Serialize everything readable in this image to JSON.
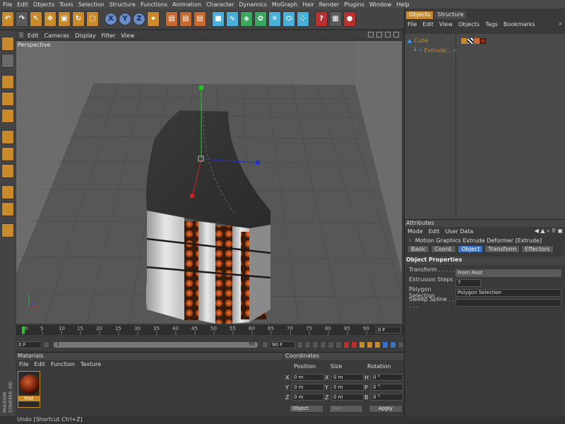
{
  "menubar": [
    "File",
    "Edit",
    "Objects",
    "Tools",
    "Selection",
    "Structure",
    "Functions",
    "Animation",
    "Character",
    "Dynamics",
    "MoGraph",
    "Hair",
    "Render",
    "Plugins",
    "Window",
    "Help"
  ],
  "toolbar": {
    "axis_x": "X",
    "axis_y": "Y",
    "axis_z": "Z"
  },
  "viewport": {
    "menu": [
      "Edit",
      "Cameras",
      "Display",
      "Filter",
      "View"
    ],
    "label": "Perspective"
  },
  "timeline": {
    "ticks": [
      "0",
      "5",
      "10",
      "15",
      "20",
      "25",
      "30",
      "35",
      "40",
      "45",
      "50",
      "55",
      "60",
      "65",
      "70",
      "75",
      "80",
      "85",
      "90"
    ],
    "current_frame": "0 F",
    "start_frame": "0 F",
    "slider_value": "1",
    "slider_end_value": "90",
    "end_frame": "90 F"
  },
  "materials": {
    "title": "Materials",
    "menu": [
      "File",
      "Edit",
      "Function",
      "Texture"
    ],
    "item_name": "Mat"
  },
  "coordinates": {
    "title": "Coordinates",
    "headers": [
      "Position",
      "Size",
      "Rotation"
    ],
    "rows": [
      {
        "axis_pos": "X",
        "pos": "0 m",
        "axis_size": "X",
        "size": "0 m",
        "axis_rot": "H",
        "rot": "0 °"
      },
      {
        "axis_pos": "Y",
        "pos": "0 m",
        "axis_size": "Y",
        "size": "0 m",
        "axis_rot": "P",
        "rot": "0 °"
      },
      {
        "axis_pos": "Z",
        "pos": "0 m",
        "axis_size": "Z",
        "size": "0 m",
        "axis_rot": "B",
        "rot": "0 °"
      }
    ],
    "mode_select": "Object",
    "size_select": "Size",
    "apply_label": "Apply"
  },
  "status": "Undo [Shortcut Ctrl+Z]",
  "logo": "MAXON CINEMA 4D",
  "object_manager": {
    "tabs": [
      "Objects",
      "Structure"
    ],
    "menu": [
      "File",
      "Edit",
      "View",
      "Objects",
      "Tags",
      "Bookmarks"
    ],
    "tree": [
      {
        "name": "Cube"
      },
      {
        "name": "Extrude"
      }
    ]
  },
  "attributes": {
    "title": "Attributes",
    "menu": [
      "Mode",
      "Edit",
      "User Data"
    ],
    "object_label": "Motion Graphics Extrude Deformer [Extrude]",
    "tabs": [
      "Basic",
      "Coord.",
      "Object",
      "Transform",
      "Effectors"
    ],
    "active_tab": "Object",
    "section": "Object Properties",
    "props": [
      {
        "label": "Transform",
        "dots": ". . . . . . .",
        "value": "From Root"
      },
      {
        "label": "Extrusion Steps",
        "dots": ". .",
        "value": "7"
      },
      {
        "label": "Polygon Selection",
        "dots": "",
        "value": "Polygon Selection"
      },
      {
        "label": "Sweep Spline",
        "dots": ". . . . .",
        "value": ""
      }
    ]
  }
}
